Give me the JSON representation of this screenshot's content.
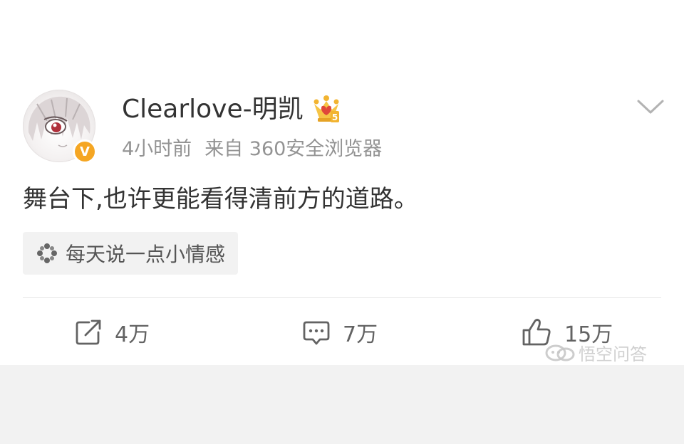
{
  "post": {
    "username": "Clearlove-明凯",
    "time": "4小时前",
    "source": "来自 360安全浏览器",
    "text": "舞台下,也许更能看得清前方的道路。",
    "topic": "每天说一点小情感",
    "verified_badge": "V",
    "vip_level": "5"
  },
  "actions": {
    "repost_count": "4万",
    "comment_count": "7万",
    "like_count": "15万"
  },
  "watermark": "悟空问答",
  "colors": {
    "text": "#333333",
    "meta": "#939393",
    "badge": "#f5a623",
    "background": "#f2f2f2"
  }
}
